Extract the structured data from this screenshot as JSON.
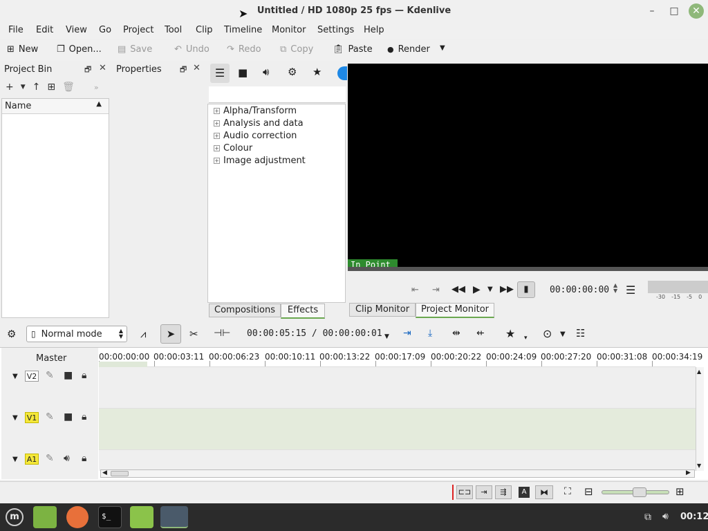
{
  "window": {
    "title": "Untitled / HD 1080p 25 fps — Kdenlive",
    "minimize": "–",
    "maximize": "□",
    "close": "✕"
  },
  "menubar": [
    "File",
    "Edit",
    "View",
    "Go",
    "Project",
    "Tool",
    "Clip",
    "Timeline",
    "Monitor",
    "Settings",
    "Help"
  ],
  "toolbar": {
    "new": "New",
    "open": "Open...",
    "save": "Save",
    "undo": "Undo",
    "redo": "Redo",
    "copy": "Copy",
    "paste": "Paste",
    "render": "Render"
  },
  "project_bin": {
    "title": "Project Bin",
    "column": "Name"
  },
  "properties": {
    "title": "Properties"
  },
  "effects": {
    "items": [
      "Alpha/Transform",
      "Analysis and data",
      "Audio correction",
      "Colour",
      "Image adjustment"
    ],
    "tabs": [
      "Compositions",
      "Effects"
    ]
  },
  "monitor": {
    "in_point": "In Point",
    "timecode": "00:00:00:00",
    "audio_scale": [
      "-30",
      "-15",
      "-5",
      "0"
    ],
    "tabs": [
      "Clip Monitor",
      "Project Monitor"
    ]
  },
  "timeline_toolbar": {
    "mode": "Normal mode",
    "position": "00:00:05:15 / 00:00:00:01"
  },
  "timeline": {
    "master": "Master",
    "ruler": [
      "00:00:00:00",
      "00:00:03:11",
      "00:00:06:23",
      "00:00:10:11",
      "00:00:13:22",
      "00:00:17:09",
      "00:00:20:22",
      "00:00:24:09",
      "00:00:27:20",
      "00:00:31:08",
      "00:00:34:19"
    ],
    "tracks": [
      {
        "name": "V2",
        "highlight": false
      },
      {
        "name": "V1",
        "highlight": true
      },
      {
        "name": "A1",
        "highlight": true
      }
    ]
  },
  "taskbar": {
    "clock": "00:12"
  },
  "colors": {
    "accent_green": "#2e8b2e",
    "track_yellow": "#f5e83a",
    "v1_track_bg": "#e4ebdc"
  }
}
